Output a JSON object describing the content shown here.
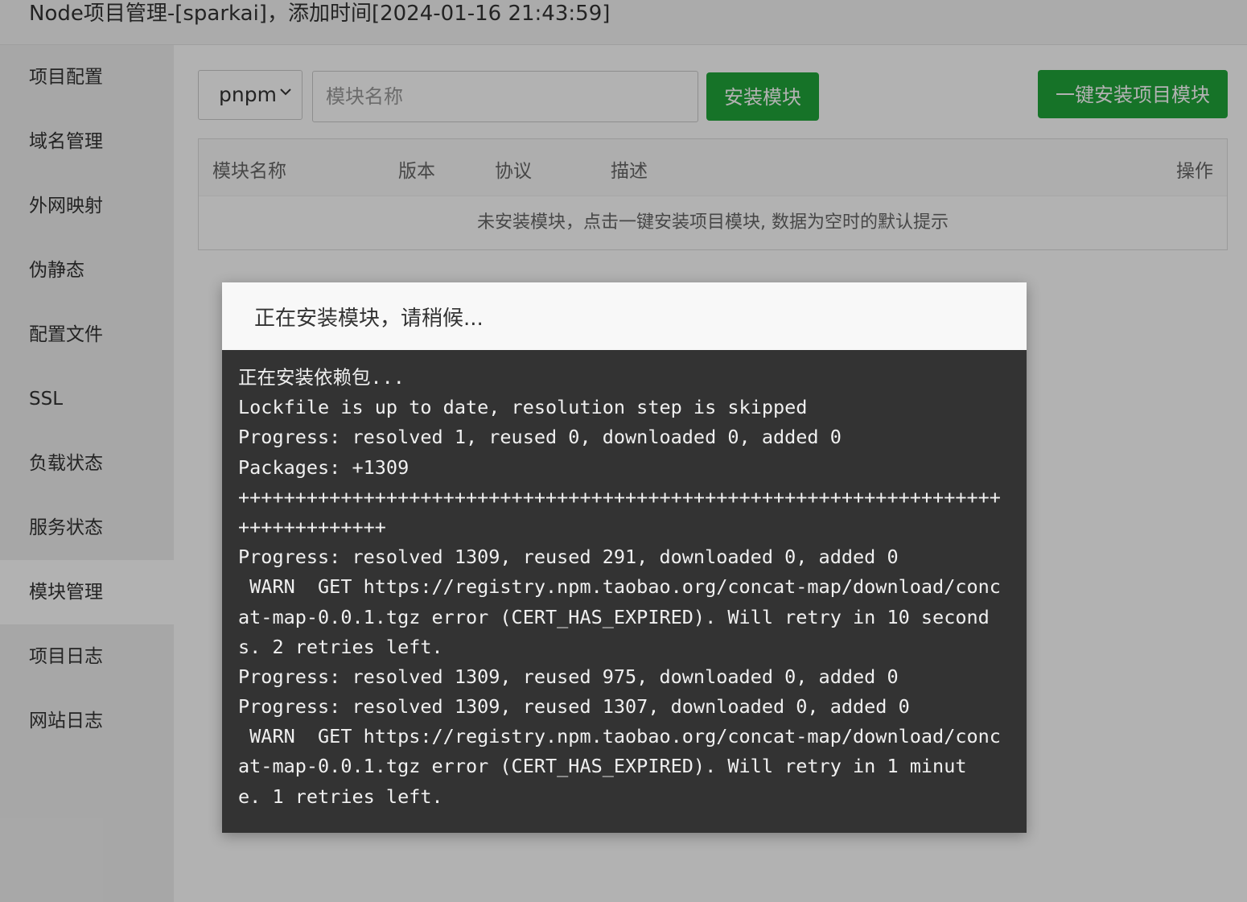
{
  "header": {
    "title": "Node项目管理-[sparkai]，添加时间[2024-01-16 21:43:59]"
  },
  "sidebar": {
    "items": [
      {
        "label": "项目配置"
      },
      {
        "label": "域名管理"
      },
      {
        "label": "外网映射"
      },
      {
        "label": "伪静态"
      },
      {
        "label": "配置文件"
      },
      {
        "label": "SSL"
      },
      {
        "label": "负载状态"
      },
      {
        "label": "服务状态"
      },
      {
        "label": "模块管理",
        "active": true
      },
      {
        "label": "项目日志"
      },
      {
        "label": "网站日志"
      }
    ]
  },
  "toolbar": {
    "package_manager": "pnpm",
    "module_placeholder": "模块名称",
    "install_label": "安装模块",
    "install_all_label": "一键安装项目模块"
  },
  "table": {
    "columns": [
      "模块名称",
      "版本",
      "协议",
      "描述",
      "操作"
    ],
    "empty_text": "未安装模块，点击一键安装项目模块, 数据为空时的默认提示"
  },
  "modal": {
    "title": "正在安装模块，请稍候...",
    "log_lines": [
      "正在安装依赖包...",
      "Lockfile is up to date, resolution step is skipped",
      "Progress: resolved 1, reused 0, downloaded 0, added 0",
      "Packages: +1309",
      "+++++++++++++++++++++++++++++++++++++++++++++++++++++++++++++++++++",
      "+++++++++++++",
      "Progress: resolved 1309, reused 291, downloaded 0, added 0",
      " WARN  GET https://registry.npm.taobao.org/concat-map/download/conc",
      "at-map-0.0.1.tgz error (CERT_HAS_EXPIRED). Will retry in 10 second",
      "s. 2 retries left.",
      "Progress: resolved 1309, reused 975, downloaded 0, added 0",
      "Progress: resolved 1309, reused 1307, downloaded 0, added 0",
      " WARN  GET https://registry.npm.taobao.org/concat-map/download/conc",
      "at-map-0.0.1.tgz error (CERT_HAS_EXPIRED). Will retry in 1 minut",
      "e. 1 retries left."
    ]
  },
  "colors": {
    "accent_green": "#20a53a",
    "console_bg": "#333333",
    "console_text": "#f0f0f0"
  }
}
